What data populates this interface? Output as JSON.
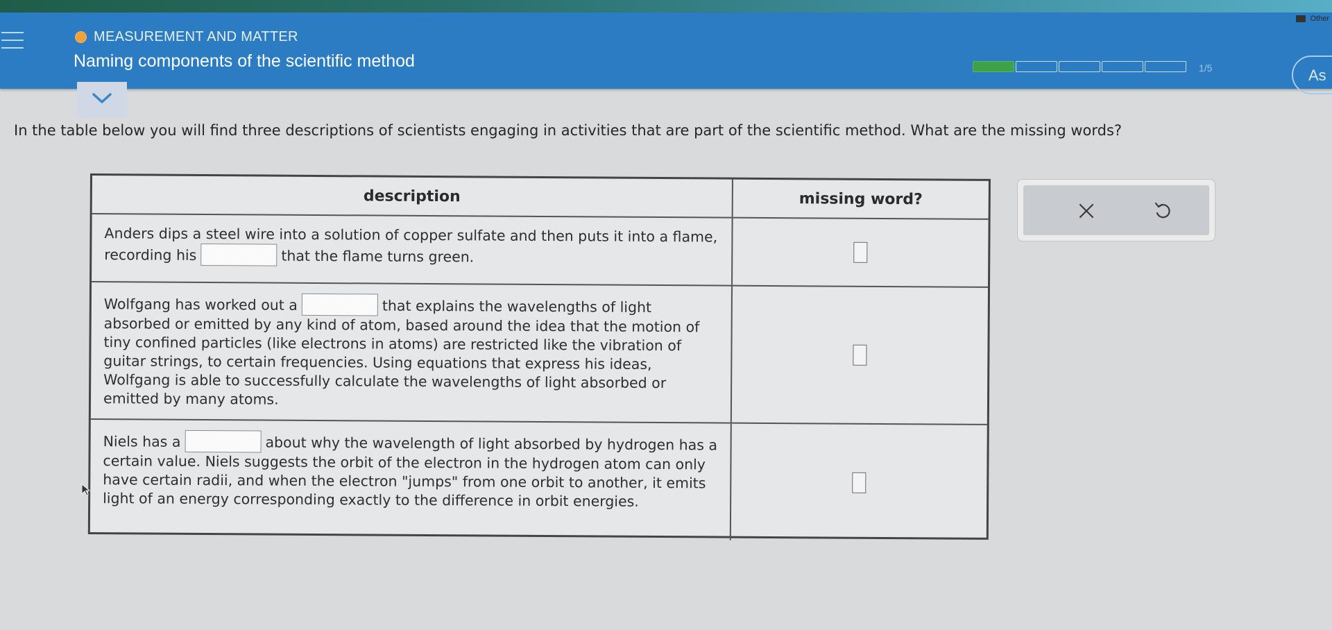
{
  "browser": {
    "bookmark_label": "Other"
  },
  "header": {
    "topic": "MEASUREMENT AND MATTER",
    "title": "Naming components of the scientific method",
    "progress": {
      "completed": 1,
      "total": 5,
      "label": "1/5"
    },
    "ask_label": "As",
    "accent_color": "#2b7cc2",
    "progress_color": "#3fa14a",
    "topic_dot_color": "#f0a23a"
  },
  "question": {
    "prompt": "In the table below you will find three descriptions of scientists engaging in activities that are part of the scientific method. What are the missing words?"
  },
  "table": {
    "headers": {
      "description": "description",
      "missing_word": "missing word?"
    },
    "rows": [
      {
        "before": "Anders dips a steel wire into a solution of copper sulfate and then puts it into a flame, recording his",
        "after": "that the flame turns green."
      },
      {
        "before": "Wolfgang has worked out a",
        "after": "that explains the wavelengths of light absorbed or emitted by any kind of atom, based around the idea that the motion of tiny confined particles (like electrons in atoms) are restricted like the vibration of guitar strings, to certain frequencies. Using equations that express his ideas, Wolfgang is able to successfully calculate the wavelengths of light absorbed or emitted by many atoms."
      },
      {
        "before": "Niels has a",
        "after": "about why the wavelength of light absorbed by hydrogen has a certain value. Niels suggests the orbit of the electron in the hydrogen atom can only have certain radii, and when the electron \"jumps\" from one orbit to another, it emits light of an energy corresponding exactly to the difference in orbit energies."
      }
    ]
  },
  "tools": {
    "clear_icon": "x-icon",
    "undo_icon": "undo-icon"
  }
}
